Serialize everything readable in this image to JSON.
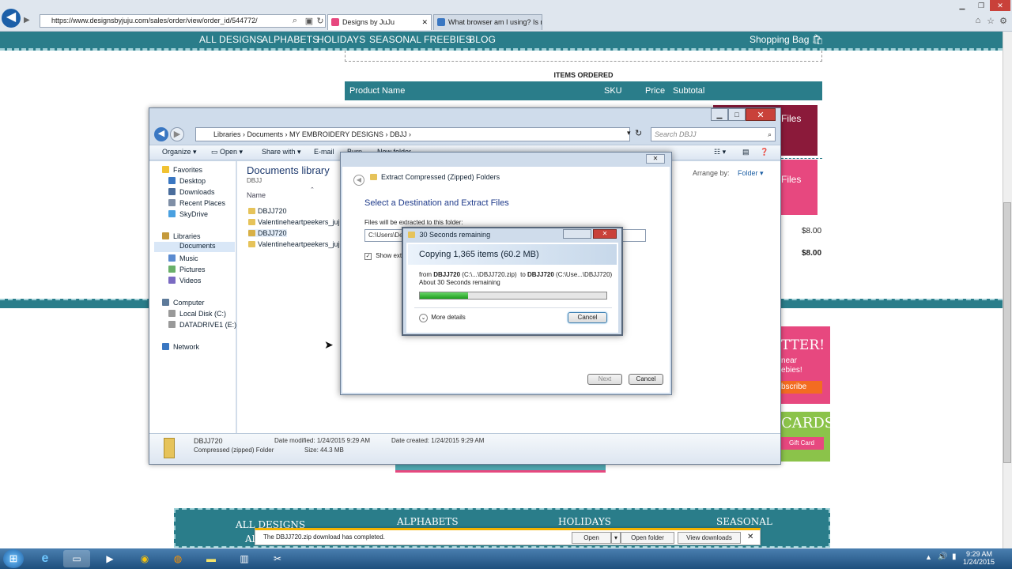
{
  "browser": {
    "url": "https://www.designsbyjuju.com/sales/order/view/order_id/544772/",
    "tabs": [
      {
        "label": "Designs by JuJu",
        "active": true
      },
      {
        "label": "What browser am I using? Is m..."
      }
    ]
  },
  "site": {
    "nav": [
      "ALL DESIGNS",
      "ALPHABETS",
      "HOLIDAYS",
      "SEASONAL",
      "FREEBIES",
      "BLOG"
    ],
    "shopping_bag": "Shopping Bag",
    "items_ordered": "ITEMS ORDERED",
    "columns": {
      "product": "Product Name",
      "sku": "SKU",
      "price": "Price",
      "subtotal": "Subtotal"
    },
    "sale1": "Files",
    "sale2": "Files",
    "price1": "$8.00",
    "price2": "$8.00",
    "newsletter": "TTER!",
    "newsletter_sub1": "near",
    "newsletter_sub2": "ebies!",
    "subscribe": "bscribe",
    "giftcards": "CARDS",
    "gift_btn": "Gift Card",
    "footer_words": [
      "ALL DESIGNS",
      "ALPHABETS",
      "HOLIDAYS",
      "SEASONAL"
    ],
    "footer_left": "Al"
  },
  "explorer": {
    "breadcrumb": "Libraries  ›  Documents  ›  MY EMBROIDERY DESIGNS  ›  DBJJ  ›",
    "search_placeholder": "Search DBJJ",
    "toolbar": {
      "organize": "Organize ▾",
      "open": "Open ▾",
      "share": "Share with ▾",
      "email": "E-mail",
      "burn": "Burn",
      "new_folder": "New folder"
    },
    "nav": {
      "favorites": "Favorites",
      "desktop": "Desktop",
      "downloads": "Downloads",
      "recent": "Recent Places",
      "skydrive": "SkyDrive",
      "libraries": "Libraries",
      "documents": "Documents",
      "music": "Music",
      "pictures": "Pictures",
      "videos": "Videos",
      "computer": "Computer",
      "local_disk": "Local Disk (C:)",
      "datadrive": "DATADRIVE1 (E:)",
      "network": "Network"
    },
    "library_title": "Documents library",
    "library_sub": "DBJJ",
    "arrange_label": "Arrange by:",
    "arrange_value": "Folder ▾",
    "col_name": "Name",
    "files": [
      "DBJJ720",
      "Valentineheartpeekers_juju",
      "DBJJ720",
      "Valentineheartpeekers_juju"
    ],
    "status": {
      "name": "DBJJ720",
      "type": "Compressed (zipped) Folder",
      "modified_label": "Date modified:",
      "modified": "1/24/2015 9:29 AM",
      "created_label": "Date created:",
      "created": "1/24/2015 9:29 AM",
      "size_label": "Size:",
      "size": "44.3 MB"
    }
  },
  "wizard": {
    "header": "Extract Compressed (Zipped) Folders",
    "title": "Select a Destination and Extract Files",
    "label": "Files will be extracted to this folder:",
    "path": "C:\\Users\\De",
    "checkbox": "Show extr",
    "next": "Next",
    "cancel": "Cancel"
  },
  "copy": {
    "title": "30 Seconds remaining",
    "heading": "Copying 1,365 items (60.2 MB)",
    "from_word": "from",
    "from_name": "DBJJ720",
    "from_path": "(C:\\...\\DBJJ720.zip)",
    "to_word": "to",
    "to_name": "DBJJ720",
    "to_path": "(C:\\Use...\\DBJJ720)",
    "remaining": "About 30 Seconds remaining",
    "progress": 0.26,
    "more_details": "More details",
    "cancel": "Cancel"
  },
  "download": {
    "message": "The DBJJ720.zip download has completed.",
    "open": "Open",
    "open_folder": "Open folder",
    "view_downloads": "View downloads"
  },
  "taskbar": {
    "time": "9:29 AM",
    "date": "1/24/2015"
  }
}
